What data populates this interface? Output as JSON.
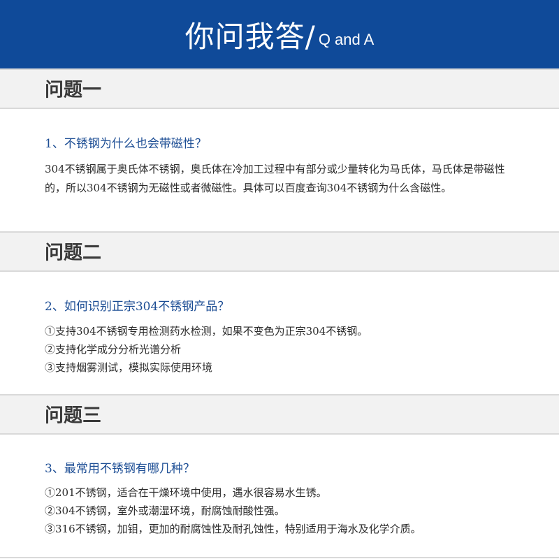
{
  "header": {
    "title_cn": "你问我答/",
    "title_en": "Q and A"
  },
  "sections": [
    {
      "heading": "问题一",
      "question": "1、不锈钢为什么也会带磁性？",
      "answer": "304不锈钢属于奥氏体不锈钢，奥氏体在冷加工过程中有部分或少量转化为马氏体，马氏体是带磁性的，所以304不锈钢为无磁性或者微磁性。具体可以百度查询304不锈钢为什么含磁性。"
    },
    {
      "heading": "问题二",
      "question": "2、如何识别正宗304不锈钢产品？",
      "lines": [
        "①支持304不锈钢专用检测药水检测，如果不变色为正宗304不锈钢。",
        "②支持化学成分分析光谱分析",
        "③支持烟雾测试，模拟实际使用环境"
      ]
    },
    {
      "heading": "问题三",
      "question": "3、最常用不锈钢有哪几种？",
      "lines": [
        "①201不锈钢，适合在干燥环境中使用，遇水很容易水生锈。",
        "②304不锈钢，室外或潮湿环境，耐腐蚀耐酸性强。",
        "③316不锈钢，加钼，更加的耐腐蚀性及耐孔蚀性，特别适用于海水及化学介质。"
      ]
    }
  ],
  "colors": {
    "header_bg": "#0f4a99",
    "question_text": "#1c4d94",
    "heading_text": "#3a3a3a",
    "bar_bg": "#f2f2f2"
  }
}
